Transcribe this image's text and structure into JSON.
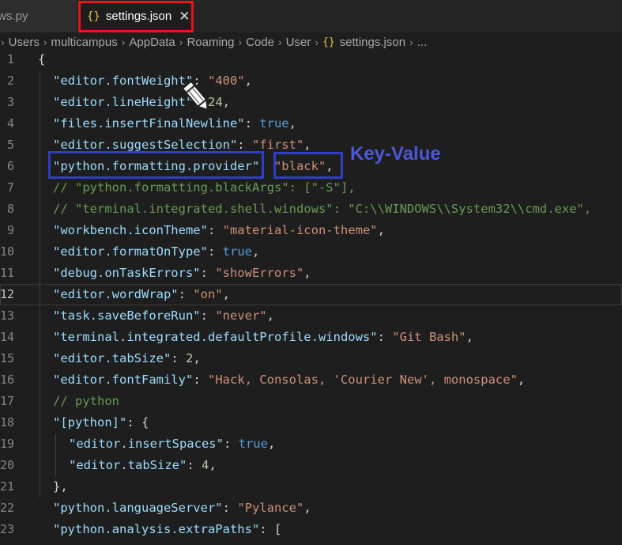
{
  "tabs": [
    {
      "label": "views.py",
      "display": "views.py"
    },
    {
      "label": "settings.json",
      "icon_glyph": "{}",
      "close_glyph": "✕"
    }
  ],
  "breadcrumb": [
    "Users",
    "multicampus",
    "AppData",
    "Roaming",
    "Code",
    "User",
    "settings.json",
    "..."
  ],
  "breadcrumb_icon_glyph": "{}",
  "annotation": {
    "label": "Key-Value",
    "color": "#4b58d8",
    "box_color": "#2f3ec4"
  },
  "current_line": 12,
  "lines": [
    {
      "num": "1",
      "tokens": [
        [
          "p",
          "{"
        ]
      ]
    },
    {
      "num": "2",
      "tokens": [
        [
          "k",
          "\"editor.fontWeight\""
        ],
        [
          "p",
          ": "
        ],
        [
          "s",
          "\"400\""
        ],
        [
          "p",
          ","
        ]
      ]
    },
    {
      "num": "3",
      "tokens": [
        [
          "k",
          "\"editor.lineHeight\""
        ],
        [
          "p",
          ": "
        ],
        [
          "n",
          "24"
        ],
        [
          "p",
          ","
        ]
      ]
    },
    {
      "num": "4",
      "tokens": [
        [
          "k",
          "\"files.insertFinalNewline\""
        ],
        [
          "p",
          ": "
        ],
        [
          "b",
          "true"
        ],
        [
          "p",
          ","
        ]
      ]
    },
    {
      "num": "5",
      "tokens": [
        [
          "k",
          "\"editor.suggestSelection\""
        ],
        [
          "p",
          ": "
        ],
        [
          "s",
          "\"first\""
        ],
        [
          "p",
          ","
        ]
      ]
    },
    {
      "num": "6",
      "tokens": [
        [
          "k",
          "\"python.formatting.provider\""
        ],
        [
          "p",
          ": "
        ],
        [
          "s",
          "\"black\""
        ],
        [
          "p",
          ","
        ]
      ]
    },
    {
      "num": "7",
      "tokens": [
        [
          "c",
          "// \"python.formatting.blackArgs\": [\"-S\"],"
        ]
      ]
    },
    {
      "num": "8",
      "tokens": [
        [
          "c",
          "// \"terminal.integrated.shell.windows\": \"C:\\\\WINDOWS\\\\System32\\\\cmd.exe\","
        ]
      ]
    },
    {
      "num": "9",
      "tokens": [
        [
          "k",
          "\"workbench.iconTheme\""
        ],
        [
          "p",
          ": "
        ],
        [
          "s",
          "\"material-icon-theme\""
        ],
        [
          "p",
          ","
        ]
      ]
    },
    {
      "num": "10",
      "tokens": [
        [
          "k",
          "\"editor.formatOnType\""
        ],
        [
          "p",
          ": "
        ],
        [
          "b",
          "true"
        ],
        [
          "p",
          ","
        ]
      ]
    },
    {
      "num": "11",
      "tokens": [
        [
          "k",
          "\"debug.onTaskErrors\""
        ],
        [
          "p",
          ": "
        ],
        [
          "s",
          "\"showErrors\""
        ],
        [
          "p",
          ","
        ]
      ]
    },
    {
      "num": "12",
      "tokens": [
        [
          "k",
          "\"editor.wordWrap\""
        ],
        [
          "p",
          ": "
        ],
        [
          "s",
          "\"on\""
        ],
        [
          "p",
          ","
        ]
      ]
    },
    {
      "num": "13",
      "tokens": [
        [
          "k",
          "\"task.saveBeforeRun\""
        ],
        [
          "p",
          ": "
        ],
        [
          "s",
          "\"never\""
        ],
        [
          "p",
          ","
        ]
      ]
    },
    {
      "num": "14",
      "tokens": [
        [
          "k",
          "\"terminal.integrated.defaultProfile.windows\""
        ],
        [
          "p",
          ": "
        ],
        [
          "s",
          "\"Git Bash\""
        ],
        [
          "p",
          ","
        ]
      ]
    },
    {
      "num": "15",
      "tokens": [
        [
          "k",
          "\"editor.tabSize\""
        ],
        [
          "p",
          ": "
        ],
        [
          "n",
          "2"
        ],
        [
          "p",
          ","
        ]
      ]
    },
    {
      "num": "16",
      "tokens": [
        [
          "k",
          "\"editor.fontFamily\""
        ],
        [
          "p",
          ": "
        ],
        [
          "s",
          "\"Hack, Consolas, 'Courier New', monospace\""
        ],
        [
          "p",
          ","
        ]
      ]
    },
    {
      "num": "17",
      "tokens": [
        [
          "c",
          "// python"
        ]
      ]
    },
    {
      "num": "18",
      "tokens": [
        [
          "k",
          "\"[python]\""
        ],
        [
          "p",
          ": {"
        ]
      ]
    },
    {
      "num": "19",
      "tokens": [
        [
          "k",
          "\"editor.insertSpaces\""
        ],
        [
          "p",
          ": "
        ],
        [
          "b",
          "true"
        ],
        [
          "p",
          ","
        ]
      ]
    },
    {
      "num": "20",
      "tokens": [
        [
          "k",
          "\"editor.tabSize\""
        ],
        [
          "p",
          ": "
        ],
        [
          "n",
          "4"
        ],
        [
          "p",
          ","
        ]
      ]
    },
    {
      "num": "21",
      "tokens": [
        [
          "p",
          "},"
        ]
      ]
    },
    {
      "num": "22",
      "tokens": [
        [
          "k",
          "\"python.languageServer\""
        ],
        [
          "p",
          ": "
        ],
        [
          "s",
          "\"Pylance\""
        ],
        [
          "p",
          ","
        ]
      ]
    },
    {
      "num": "23",
      "tokens": [
        [
          "k",
          "\"python.analysis.extraPaths\""
        ],
        [
          "p",
          ": ["
        ]
      ]
    }
  ]
}
